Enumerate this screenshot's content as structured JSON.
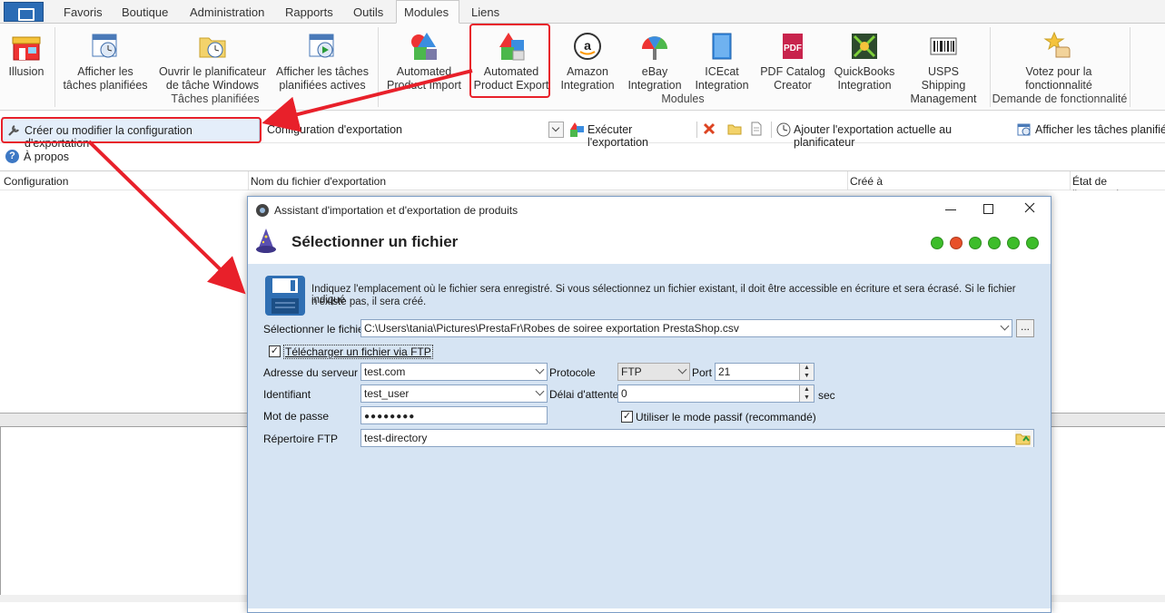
{
  "tabs": [
    "Favoris",
    "Boutique",
    "Administration",
    "Rapports",
    "Outils",
    "Modules",
    "Liens"
  ],
  "active_tab": "Modules",
  "ribbon": {
    "illusion": "Illusion",
    "scheduled": {
      "show_tasks": [
        "Afficher les",
        "tâches planifiées"
      ],
      "open_scheduler": [
        "Ouvrir le planificateur",
        "de tâche Windows"
      ],
      "show_active": [
        "Afficher les tâches",
        "planifiées actives"
      ],
      "group_label": "Tâches planifiées"
    },
    "modules": {
      "items": [
        [
          "Automated",
          "Product Import"
        ],
        [
          "Automated",
          "Product Export"
        ],
        [
          "Amazon",
          "Integration"
        ],
        [
          "eBay",
          "Integration"
        ],
        [
          "ICEcat",
          "Integration"
        ],
        [
          "PDF Catalog",
          "Creator"
        ],
        [
          "QuickBooks",
          "Integration"
        ],
        [
          "USPS Shipping",
          "Management"
        ]
      ],
      "group_label": "Modules"
    },
    "feature": {
      "vote": [
        "Votez pour la",
        "fonctionnalité"
      ],
      "group_label": "Demande de fonctionnalité"
    }
  },
  "toolbar": {
    "create_config": "Créer ou modifier la configuration d'exportation",
    "config_combo": "Configuration d'exportation",
    "run_export": "Exécuter l'exportation",
    "add_scheduler": "Ajouter l'exportation actuelle au planificateur",
    "show_tasks": "Afficher les tâches planifiées"
  },
  "about": "À propos",
  "grid": {
    "columns": [
      "Configuration",
      "Nom du fichier d'exportation",
      "Créé à",
      "État de l'exportation"
    ]
  },
  "dialog": {
    "title": "Assistant d'importation et d'exportation de produits",
    "heading": "Sélectionner un fichier",
    "info_line1": "Indiquez l'emplacement où le fichier sera enregistré. Si vous sélectionnez un fichier existant, il doit être accessible en écriture et sera écrasé. Si le fichier indiqué",
    "info_line2": "n'existe pas, il sera créé.",
    "select_file_label": "Sélectionner le fichier",
    "file_path": "C:\\Users\\tania\\Pictures\\PrestaFr\\Robes de soiree exportation PrestaShop.csv",
    "browse_label": "...",
    "ftp_upload_label": "Télécharger un fichier via FTP",
    "server_label": "Adresse du serveur",
    "server_value": "test.com",
    "protocol_label": "Protocole",
    "protocol_value": "FTP",
    "port_label": "Port",
    "port_value": "21",
    "user_label": "Identifiant",
    "user_value": "test_user",
    "timeout_label": "Délai d'attente",
    "timeout_value": "0",
    "timeout_unit": "sec",
    "password_label": "Mot de passe",
    "password_value": "●●●●●●●●",
    "passive_label": "Utiliser le mode passif (recommandé)",
    "ftp_dir_label": "Répertoire FTP",
    "ftp_dir_value": "test-directory",
    "step_colors": [
      "#3dbd2a",
      "#e8502a",
      "#3dbd2a",
      "#3dbd2a",
      "#3dbd2a",
      "#3dbd2a"
    ]
  },
  "colors": {
    "annotation": "#e8202a",
    "dialog_body": "#d6e4f3"
  }
}
